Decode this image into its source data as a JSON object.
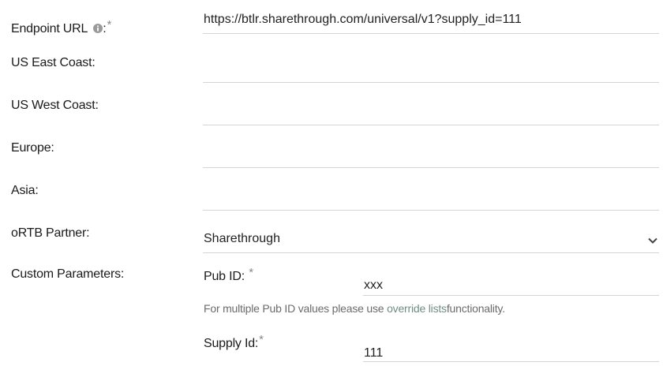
{
  "endpoint": {
    "label": "Endpoint URL",
    "colon": ":",
    "required": "*",
    "value": "https://btlr.sharethrough.com/universal/v1?supply_id=111"
  },
  "us_east": {
    "label": "US East Coast:",
    "value": ""
  },
  "us_west": {
    "label": "US West Coast:",
    "value": ""
  },
  "europe": {
    "label": "Europe:",
    "value": ""
  },
  "asia": {
    "label": "Asia:",
    "value": ""
  },
  "ortb": {
    "label": "oRTB Partner:",
    "selected": "Sharethrough"
  },
  "custom": {
    "label": "Custom Parameters:",
    "pub_id": {
      "label": "Pub ID:",
      "required": "*",
      "value": "xxx"
    },
    "help": {
      "prefix": "For multiple Pub ID values please use ",
      "link": "override lists",
      "suffix": "functionality."
    },
    "supply_id": {
      "label": "Supply Id:",
      "required": "*",
      "value": "111"
    }
  },
  "icons": {
    "info": "info-icon",
    "dropdown": "chevron-down-icon"
  },
  "colors": {
    "link": "#6f8e83",
    "border": "#d4d4d4",
    "muted": "#8a8a8a"
  }
}
